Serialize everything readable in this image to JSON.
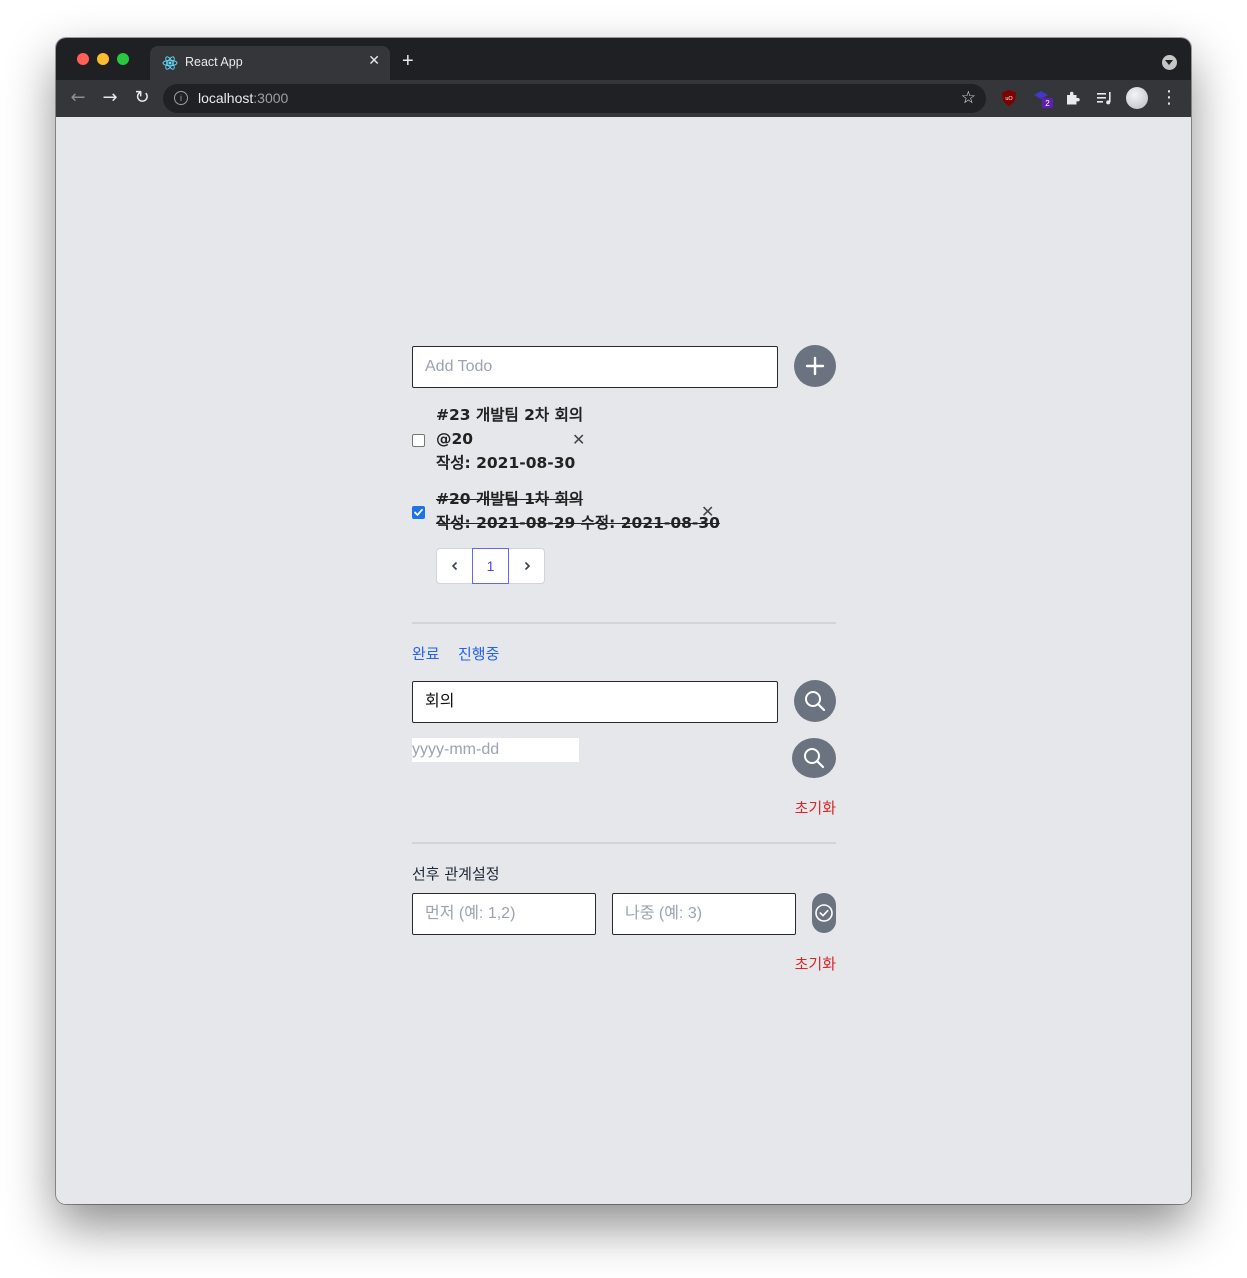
{
  "browser": {
    "tab_title": "React App",
    "tab_close": "✕",
    "new_tab": "+",
    "url_host": "localhost",
    "url_port": ":3000",
    "extension_badge": "2"
  },
  "todo_input": {
    "placeholder": "Add Todo"
  },
  "todos": [
    {
      "line1": "#23 개발팀 2차 회의",
      "line2": "@20",
      "line3": "작성: 2021-08-30",
      "done": false
    },
    {
      "line1": "#20 개발팀 1차 회의",
      "line2": "작성: 2021-08-29 수정: 2021-08-30",
      "done": true
    }
  ],
  "delete_icon": "✕",
  "pagination": {
    "prev": "‹",
    "page": "1",
    "next": "›"
  },
  "filters": {
    "done": "완료",
    "in_progress": "진행중"
  },
  "search": {
    "value": "회의",
    "date_placeholder": "yyyy-mm-dd",
    "reset": "초기화"
  },
  "relation": {
    "label": "선후 관계설정",
    "first_placeholder": "먼저 (예: 1,2)",
    "later_placeholder": "나중 (예: 3)",
    "reset": "초기화"
  },
  "colors": {
    "page_bg": "#e5e7eb",
    "button_gray": "#6b7280",
    "link_blue": "#2563eb",
    "reset_red": "#dc2626",
    "active_page": "#4f46e5"
  }
}
